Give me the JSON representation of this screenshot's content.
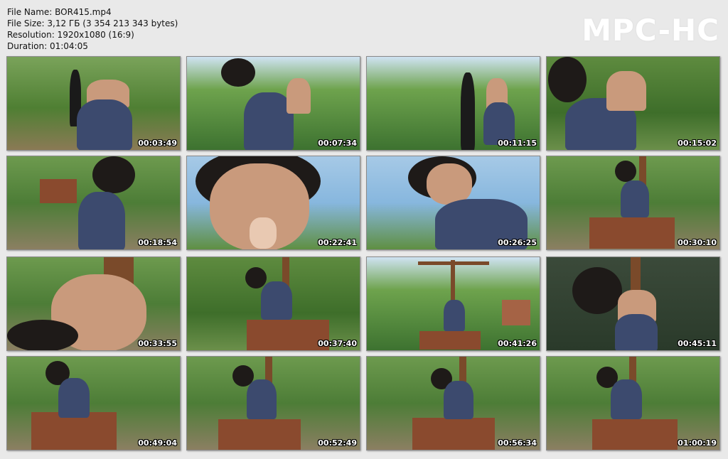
{
  "info": {
    "file_name": "File Name: BOR415.mp4",
    "file_size": "File Size: 3,12 ГБ (3 354 213 343 bytes)",
    "resolution": "Resolution: 1920x1080 (16:9)",
    "duration": "Duration: 01:04:05"
  },
  "logo": "MPC-HC",
  "thumbnails": [
    {
      "time": "00:03:49"
    },
    {
      "time": "00:07:34"
    },
    {
      "time": "00:11:15"
    },
    {
      "time": "00:15:02"
    },
    {
      "time": "00:18:54"
    },
    {
      "time": "00:22:41"
    },
    {
      "time": "00:26:25"
    },
    {
      "time": "00:30:10"
    },
    {
      "time": "00:33:55"
    },
    {
      "time": "00:37:40"
    },
    {
      "time": "00:41:26"
    },
    {
      "time": "00:45:11"
    },
    {
      "time": "00:49:04"
    },
    {
      "time": "00:52:49"
    },
    {
      "time": "00:56:34"
    },
    {
      "time": "01:00:19"
    }
  ]
}
